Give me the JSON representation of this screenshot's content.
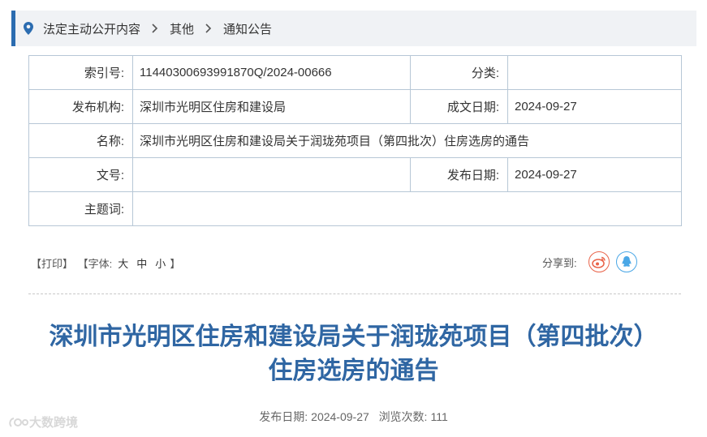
{
  "breadcrumb": {
    "items": [
      "法定主动公开内容",
      "其他",
      "通知公告"
    ]
  },
  "meta": {
    "index_label": "索引号:",
    "index_value": "11440300693991870Q/2024-00666",
    "category_label": "分类:",
    "category_value": "",
    "publisher_label": "发布机构:",
    "publisher_value": "深圳市光明区住房和建设局",
    "written_date_label": "成文日期:",
    "written_date_value": "2024-09-27",
    "name_label": "名称:",
    "name_value": "深圳市光明区住房和建设局关于润珑苑项目（第四批次）住房选房的通告",
    "doc_no_label": "文号:",
    "doc_no_value": "",
    "publish_date_label": "发布日期:",
    "publish_date_value": "2024-09-27",
    "keywords_label": "主题词:",
    "keywords_value": ""
  },
  "tools": {
    "print_label": "【打印】",
    "font_prefix": "【字体:",
    "font_large": "大",
    "font_medium": "中",
    "font_small": "小",
    "font_suffix": "】"
  },
  "share": {
    "label": "分享到:",
    "weibo_icon": "weibo-icon",
    "qq_icon": "qq-icon"
  },
  "article": {
    "title_line1": "深圳市光明区住房和建设局关于润珑苑项目（第四批次）",
    "title_line2": "住房选房的通告",
    "publish_label": "发布日期:",
    "publish_date": "2024-09-27",
    "views_label": "浏览次数:",
    "views": "111"
  },
  "watermark": {
    "text": "大数跨境"
  },
  "colors": {
    "accent": "#2b6cb0",
    "title": "#2f66a3",
    "border": "#b7c7d6",
    "weibo": "#e9644a",
    "qq": "#4aa7e6"
  }
}
